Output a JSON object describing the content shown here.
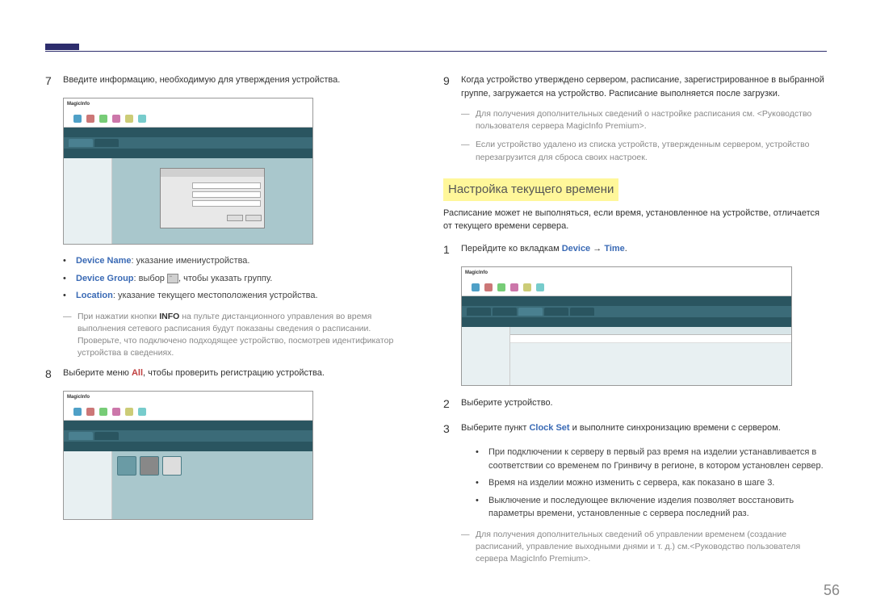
{
  "page_number": "56",
  "left": {
    "step7": {
      "num": "7",
      "text": "Введите информацию, необходимую для утверждения устройства."
    },
    "bullets": {
      "deviceName": {
        "label": "Device Name",
        "text": ": указание имениустройства."
      },
      "deviceGroup": {
        "label": "Device Group",
        "text1": ": выбор ",
        "text2": ", чтобы указать группу."
      },
      "location": {
        "label": "Location",
        "text": ": указание текущего местоположения устройства."
      }
    },
    "note7": {
      "pre": "При нажатии кнопки ",
      "bold": "INFO",
      "post": " на пульте дистанционного управления во время выполнения сетевого расписания будут показаны сведения о расписании. Проверьте, что подключено подходящее устройство, посмотрев идентификатор устройства в сведениях."
    },
    "step8": {
      "num": "8",
      "text1": "Выберите меню ",
      "all": "All",
      "text2": ", чтобы проверить регистрацию устройства."
    }
  },
  "right": {
    "step9": {
      "num": "9",
      "text": "Когда устройство утверждено сервером, расписание, зарегистрированное в выбранной группе, загружается на устройство. Расписание выполняется после загрузки."
    },
    "note9a": "Для получения дополнительных сведений о настройке расписания см. <Руководство пользователя сервера MagicInfo Premium>.",
    "note9b": "Если устройство удалено из списка устройств, утвержденным сервером, устройство перезагрузится для сброса своих настроек.",
    "section": "Настройка текущего времени",
    "intro": "Расписание может не выполняться, если время, установленное на устройстве, отличается от текущего времени сервера.",
    "step1": {
      "num": "1",
      "text1": "Перейдите ко вкладкам ",
      "device": "Device",
      "arrow": " → ",
      "time": "Time",
      "dot": "."
    },
    "step2": {
      "num": "2",
      "text": "Выберите устройство."
    },
    "step3": {
      "num": "3",
      "text1": "Выберите пункт ",
      "clockset": "Clock Set",
      "text2": " и выполните синхронизацию времени с сервером."
    },
    "sub": {
      "a": "При подключении к серверу в первый раз время на изделии устанавливается в соответствии со временем по Гринвичу в регионе, в котором установлен сервер.",
      "b": "Время на изделии можно изменить с сервера, как показано в шаге 3.",
      "c": "Выключение и последующее включение изделия позволяет восстановить параметры времени, установленные с сервера последний раз."
    },
    "noteEnd": "Для получения дополнительных сведений об управлении временем (создание расписаний, управление выходными днями и т. д.) см.<Руководство пользователя сервера MagicInfo Premium>."
  },
  "ss_logo": "MagicInfo"
}
